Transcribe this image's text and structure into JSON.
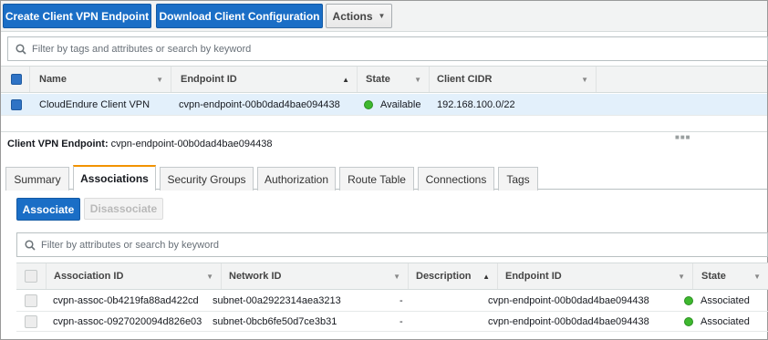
{
  "toolbar": {
    "create_label": "Create Client VPN Endpoint",
    "download_label": "Download Client Configuration",
    "actions_label": "Actions"
  },
  "search_top": {
    "placeholder": "Filter by tags and attributes or search by keyword"
  },
  "endpoints_table": {
    "columns": [
      "Name",
      "Endpoint ID",
      "State",
      "Client CIDR"
    ],
    "rows": [
      {
        "name": "CloudEndure Client VPN",
        "endpoint_id": "cvpn-endpoint-00b0dad4bae094438",
        "state": "Available",
        "client_cidr": "192.168.100.0/22"
      }
    ]
  },
  "details": {
    "label": "Client VPN Endpoint:",
    "endpoint_id": "cvpn-endpoint-00b0dad4bae094438"
  },
  "tabs": [
    "Summary",
    "Associations",
    "Security Groups",
    "Authorization",
    "Route Table",
    "Connections",
    "Tags"
  ],
  "active_tab": "Associations",
  "assoc": {
    "associate_label": "Associate",
    "disassociate_label": "Disassociate",
    "search_placeholder": "Filter by attributes or search by keyword",
    "columns": [
      "Association ID",
      "Network ID",
      "Description",
      "Endpoint ID",
      "State"
    ],
    "rows": [
      {
        "association_id": "cvpn-assoc-0b4219fa88ad422cd",
        "network_id": "subnet-00a2922314aea3213",
        "description": "-",
        "endpoint_id": "cvpn-endpoint-00b0dad4bae094438",
        "state": "Associated"
      },
      {
        "association_id": "cvpn-assoc-0927020094d826e03",
        "network_id": "subnet-0bcb6fe50d7ce3b31",
        "description": "-",
        "endpoint_id": "cvpn-endpoint-00b0dad4bae094438",
        "state": "Associated"
      }
    ]
  },
  "colors": {
    "primary": "#1a6ec6",
    "selected_row": "#e3f0fb",
    "status_green": "#3eb82f",
    "tab_accent": "#f29300"
  },
  "icons": {
    "search": "search-icon",
    "caret": "caret-down-icon",
    "sort_asc": "sort-ascending-icon",
    "sort_desc": "sort-descending-icon"
  }
}
